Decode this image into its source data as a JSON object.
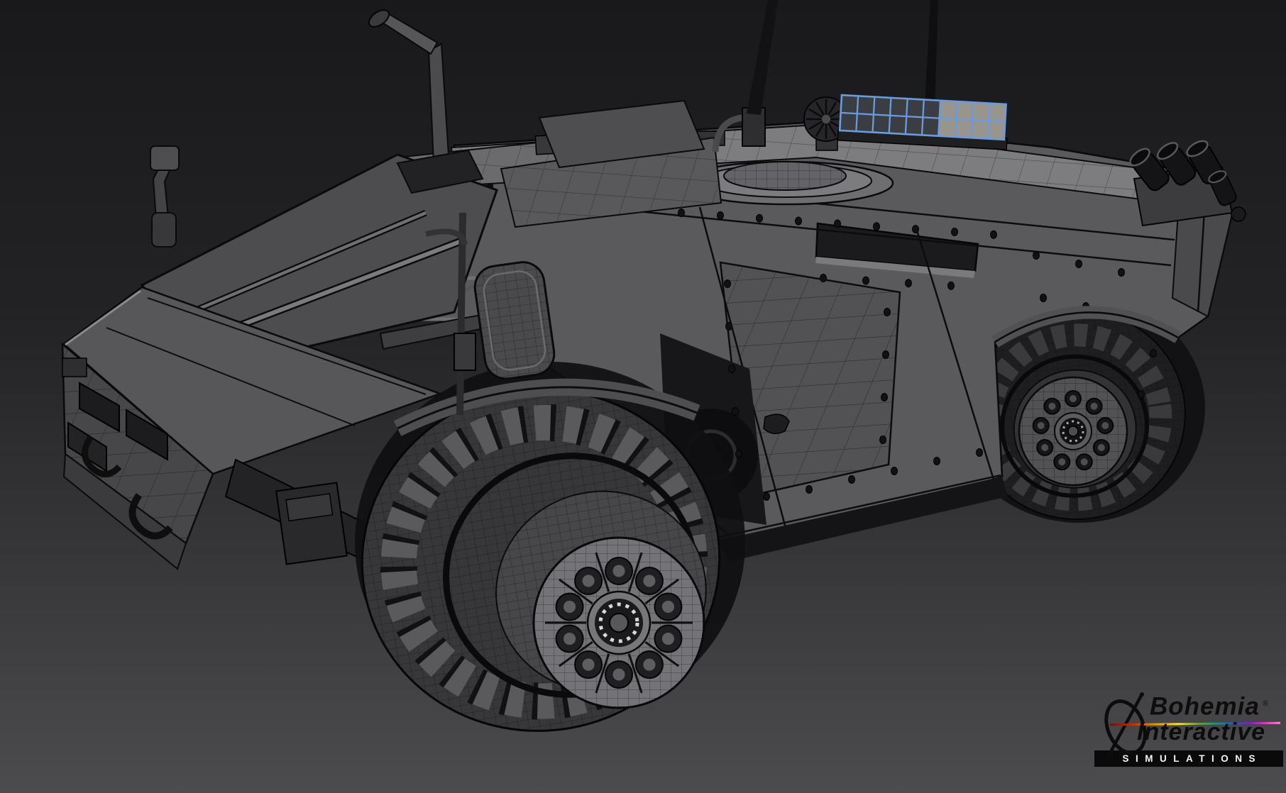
{
  "scene": {
    "background_top": "#19191b",
    "background_bottom": "#4c4c4e",
    "wireframe_line_color": "#0a0a0a",
    "model_gray": "#59595c"
  },
  "selected_panel": {
    "rows": 2,
    "cols": 10,
    "accent": "#6b9ade",
    "cell_fill_dark": "#3a3d42",
    "cell_fill_light": "#97958d",
    "light_cols_from": 6
  },
  "logo": {
    "brand_line1": "Bohemia",
    "registered_mark": "®",
    "brand_line2": "Interactive",
    "sub_brand": "SIMULATIONS",
    "text_color": "#0d0d0d",
    "bar_background": "#0a0a0a",
    "bar_text_color": "#f4f4f4"
  }
}
